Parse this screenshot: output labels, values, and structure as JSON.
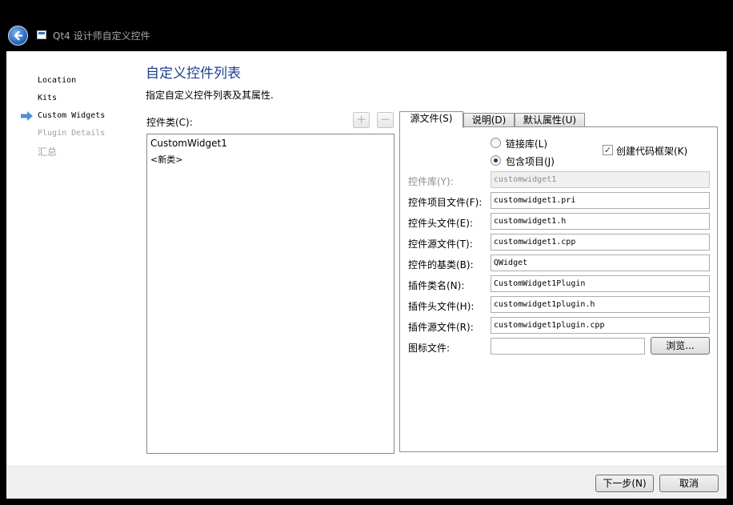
{
  "window": {
    "title": "Qt4 设计师自定义控件"
  },
  "steps": [
    {
      "label": "Location",
      "state": "done"
    },
    {
      "label": "Kits",
      "state": "done"
    },
    {
      "label": "Custom Widgets",
      "state": "current"
    },
    {
      "label": "Plugin Details",
      "state": "disabled"
    },
    {
      "label": "汇总",
      "state": "disabled"
    }
  ],
  "page": {
    "title": "自定义控件列表",
    "subtitle": "指定自定义控件列表及其属性."
  },
  "class_list": {
    "label": "控件类(C):",
    "add_symbol": "+",
    "remove_symbol": "−",
    "items": [
      "CustomWidget1",
      "<新类>"
    ]
  },
  "tabs": [
    {
      "label": "源文件(S)",
      "active": true
    },
    {
      "label": "说明(D)",
      "active": false
    },
    {
      "label": "默认属性(U)",
      "active": false
    }
  ],
  "source_tab": {
    "radio_link_library": {
      "label": "链接库(L)",
      "checked": false
    },
    "radio_include_project": {
      "label": "包含项目(J)",
      "checked": true
    },
    "create_skeleton": {
      "label": "创建代码框架(K)",
      "checked": true
    },
    "fields": [
      {
        "label": "控件库(Y):",
        "value": "customwidget1",
        "disabled": true
      },
      {
        "label": "控件项目文件(F):",
        "value": "customwidget1.pri",
        "disabled": false
      },
      {
        "label": "控件头文件(E):",
        "value": "customwidget1.h",
        "disabled": false
      },
      {
        "label": "控件源文件(T):",
        "value": "customwidget1.cpp",
        "disabled": false
      },
      {
        "label": "控件的基类(B):",
        "value": "QWidget",
        "disabled": false
      },
      {
        "label": "插件类名(N):",
        "value": "CustomWidget1Plugin",
        "disabled": false
      },
      {
        "label": "插件头文件(H):",
        "value": "customwidget1plugin.h",
        "disabled": false
      },
      {
        "label": "插件源文件(R):",
        "value": "customwidget1plugin.cpp",
        "disabled": false
      }
    ],
    "icon_file": {
      "label": "图标文件:",
      "value": "",
      "browse_label": "浏览..."
    }
  },
  "footer": {
    "next_label": "下一步(N)",
    "cancel_label": "取消"
  },
  "colors": {
    "title_accent": "#1f3f8f",
    "step_arrow": "#4a90d9"
  }
}
